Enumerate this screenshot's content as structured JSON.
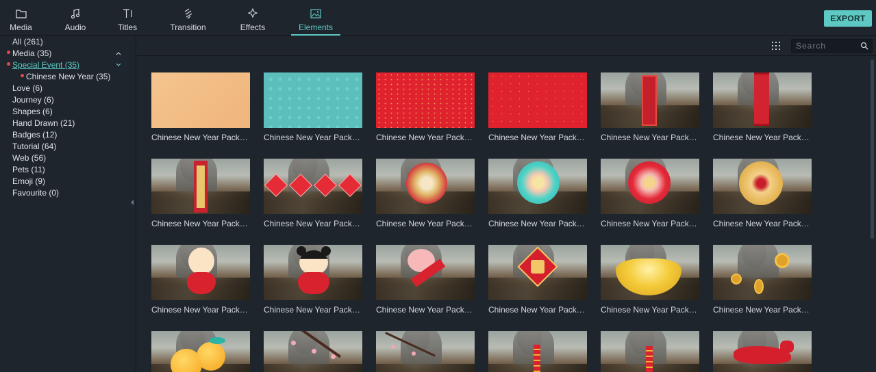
{
  "toolbar": {
    "tabs": [
      {
        "label": "Media",
        "icon": "folder-icon"
      },
      {
        "label": "Audio",
        "icon": "music-note-icon"
      },
      {
        "label": "Titles",
        "icon": "text-icon"
      },
      {
        "label": "Transition",
        "icon": "transition-icon"
      },
      {
        "label": "Effects",
        "icon": "effects-icon"
      },
      {
        "label": "Elements",
        "icon": "image-icon"
      }
    ],
    "active_tab": "Elements",
    "export_label": "EXPORT"
  },
  "sidebar": {
    "categories": [
      {
        "label": "All (261)"
      },
      {
        "label": "Media (35)"
      },
      {
        "label": "Special Event (35)"
      },
      {
        "label": "Chinese New Year (35)"
      },
      {
        "label": "Love (6)"
      },
      {
        "label": "Journey (6)"
      },
      {
        "label": "Shapes (6)"
      },
      {
        "label": "Hand Drawn (21)"
      },
      {
        "label": "Badges (12)"
      },
      {
        "label": "Tutorial (64)"
      },
      {
        "label": "Web (56)"
      },
      {
        "label": "Pets (11)"
      },
      {
        "label": "Emoji (9)"
      },
      {
        "label": "Favourite (0)"
      }
    ],
    "selected": "Special Event (35)"
  },
  "search": {
    "placeholder": "Search"
  },
  "grid": {
    "caption": "Chinese New Year Pack El...",
    "items": [
      "peach-background",
      "teal-background",
      "red-sparkle-background",
      "red-background",
      "red-scroll-banner",
      "red-scroll-banner-2",
      "red-scroll-vertical",
      "red-diamond-banners",
      "gold-paper-flower",
      "teal-paper-flower",
      "red-paper-flower",
      "gold-red-paper-flower",
      "chinese-boy",
      "chinese-girl",
      "pig-with-banner",
      "fu-diamond",
      "gold-ingot",
      "gold-coins",
      "tangerines",
      "plum-blossom",
      "plum-blossom-2",
      "firecracker",
      "firecracker-2",
      "red-paper-dog"
    ]
  },
  "colors": {
    "accent": "#5ec8c3",
    "background": "#1e252d",
    "dot": "#e54a4a"
  }
}
